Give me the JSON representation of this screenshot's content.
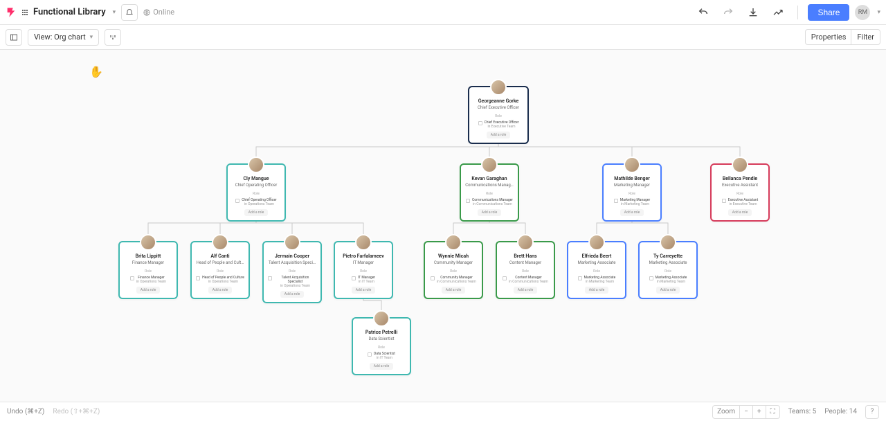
{
  "header": {
    "title": "Functional Library",
    "status": "Online",
    "share": "Share",
    "user_initials": "RM"
  },
  "toolbar": {
    "view_label": "View: Org chart",
    "properties": "Properties",
    "filter": "Filter"
  },
  "labels": {
    "role": "Role",
    "add_role": "Add a role"
  },
  "people": {
    "ceo": {
      "name": "Georgeanne Gorke",
      "title": "Chief Executive Officer",
      "role": "Chief Executive Officer",
      "team": "in Executive Team"
    },
    "coo": {
      "name": "Cly Mangue",
      "title": "Chief Operating Officer",
      "role": "Chief Operating Officer",
      "team": "in Operations Team"
    },
    "comms": {
      "name": "Kevan Garaghan",
      "title": "Communications Manag…",
      "role": "Communications Manager",
      "team": "in Communications Team"
    },
    "mkt_mgr": {
      "name": "Mathilde Benger",
      "title": "Marketing Manager",
      "role": "Marketing Manager",
      "team": "in Marketing Team"
    },
    "ea": {
      "name": "Bellanca Pendle",
      "title": "Executive Assistant",
      "role": "Executive Assistant",
      "team": "in Executive Team"
    },
    "fin": {
      "name": "Brita Lippitt",
      "title": "Finance Manager",
      "role": "Finance Manager",
      "team": "in Operations Team"
    },
    "hr": {
      "name": "Alf Canti",
      "title": "Head of People and Cult…",
      "role": "Head of People and Culture",
      "team": "in Operations Team"
    },
    "ta": {
      "name": "Jermain Cooper",
      "title": "Talent Acquisition Speci…",
      "role": "Talent Acquisition Specialist",
      "team": "in Operations Team"
    },
    "it": {
      "name": "Pietro Farfalameev",
      "title": "IT Manager",
      "role": "IT Manager",
      "team": "in IT Team"
    },
    "cm": {
      "name": "Wynnie Micah",
      "title": "Community Manager",
      "role": "Community Manager",
      "team": "in Communications Team"
    },
    "content": {
      "name": "Brett Hans",
      "title": "Content Manager",
      "role": "Content Manager",
      "team": "in Communications Team"
    },
    "mkt1": {
      "name": "Elfrieda Beert",
      "title": "Marketing Associate",
      "role": "Marketing Associate",
      "team": "in Marketing Team"
    },
    "mkt2": {
      "name": "Ty Carreyette",
      "title": "Marketing Associate",
      "role": "Marketing Associate",
      "team": "in Marketing Team"
    },
    "data": {
      "name": "Patrice Petrelli",
      "title": "Data Scientist",
      "role": "Data Scientist",
      "team": "in IT Team"
    }
  },
  "footer": {
    "undo": "Undo (⌘+Z)",
    "redo": "Redo (⇧+⌘+Z)",
    "zoom": "Zoom",
    "teams": "Teams: 5",
    "people": "People: 14"
  }
}
